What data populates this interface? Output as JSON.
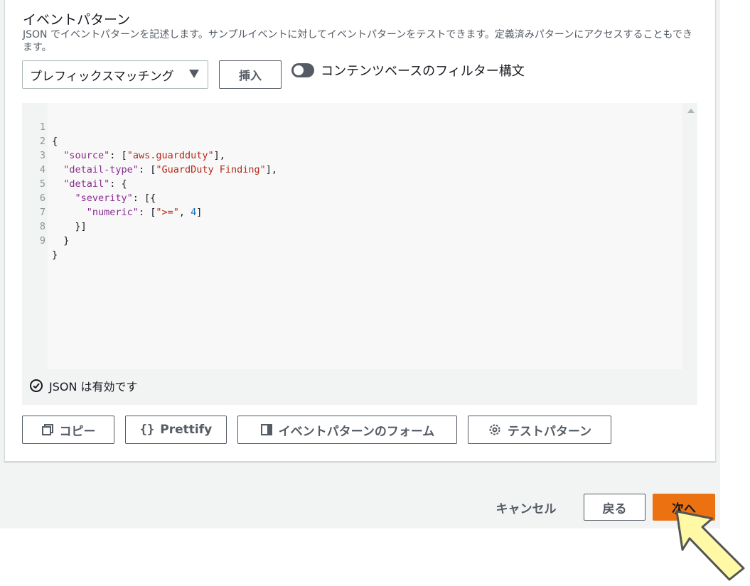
{
  "section": {
    "title": "イベントパターン",
    "description": "JSON でイベントパターンを記述します。サンプルイベントに対してイベントパターンをテストできます。定義済みパターンにアクセスすることもできます。"
  },
  "controls": {
    "match_select_value": "プレフィックスマッチング",
    "insert_label": "挿入",
    "toggle_label": "コンテンツベースのフィルター構文",
    "toggle_on": false
  },
  "editor": {
    "line_numbers": [
      "1",
      "2",
      "3",
      "4",
      "5",
      "6",
      "7",
      "8",
      "9"
    ],
    "lines": [
      "{",
      "  \"source\": [\"aws.guardduty\"],",
      "  \"detail-type\": [\"GuardDuty Finding\"],",
      "  \"detail\": {",
      "    \"severity\": [{",
      "      \"numeric\": [\">=\", 4]",
      "    }]",
      "  }",
      "}"
    ],
    "validity_text": "JSON は有効です"
  },
  "actions": {
    "copy_label": "コピー",
    "prettify_label": "Prettify",
    "form_label": "イベントパターンのフォーム",
    "test_label": "テストパターン"
  },
  "footer": {
    "cancel_label": "キャンセル",
    "back_label": "戻る",
    "next_label": "次へ"
  },
  "colors": {
    "primary": "#ec7211",
    "cursor_fill": "#fff9a6"
  }
}
